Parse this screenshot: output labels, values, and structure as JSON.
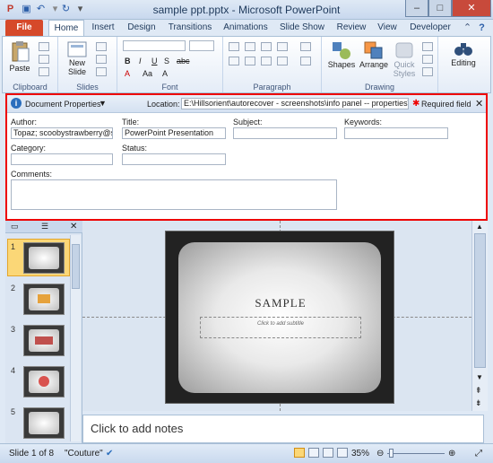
{
  "window": {
    "title": "sample ppt.pptx - Microsoft PowerPoint",
    "minimize": "–",
    "maximize": "□",
    "close": "✕"
  },
  "tabs": [
    "File",
    "Home",
    "Insert",
    "Design",
    "Transitions",
    "Animations",
    "Slide Show",
    "Review",
    "View",
    "Developer"
  ],
  "ribbon": {
    "groups": {
      "clipboard": "Clipboard",
      "slides": "Slides",
      "font": "Font",
      "paragraph": "Paragraph",
      "drawing": "Drawing"
    },
    "paste": "Paste",
    "new_slide_1": "New",
    "new_slide_2": "Slide",
    "shapes": "Shapes",
    "arrange": "Arrange",
    "quick_styles_1": "Quick",
    "quick_styles_2": "Styles",
    "editing": "Editing",
    "font_letters": [
      "B",
      "I",
      "U",
      "S",
      "abc",
      "A",
      "Aa",
      "A"
    ]
  },
  "doc_panel": {
    "title": "Document Properties",
    "location_label": "Location:",
    "location_value": "E:\\Hillsorient\\autorecover - screenshots\\info panel -- properties\\sampl",
    "required": "Required field",
    "fields": {
      "author_label": "Author:",
      "author_value": "Topaz; scoobystrawberry@sco",
      "title_label": "Title:",
      "title_value": "PowerPoint Presentation",
      "subject_label": "Subject:",
      "subject_value": "",
      "keywords_label": "Keywords:",
      "keywords_value": "",
      "category_label": "Category:",
      "category_value": "",
      "status_label": "Status:",
      "status_value": "",
      "comments_label": "Comments:",
      "comments_value": ""
    }
  },
  "slides": [
    "1",
    "2",
    "3",
    "4",
    "5"
  ],
  "slide": {
    "title": "SAMPLE",
    "subtitle": "Click to add subtitle"
  },
  "notes": {
    "placeholder": "Click to add notes"
  },
  "status": {
    "slide": "Slide 1 of 8",
    "theme": "\"Couture\"",
    "zoom": "35%"
  },
  "colors": {
    "file_tab": "#d6492a",
    "highlight": "#e00000"
  }
}
